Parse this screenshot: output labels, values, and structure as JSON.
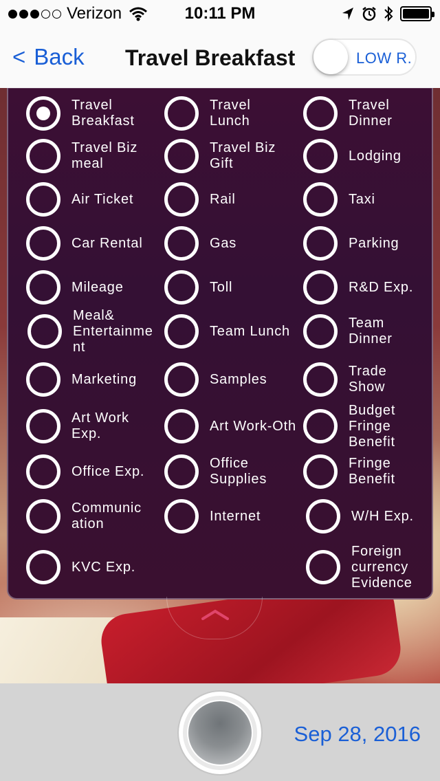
{
  "status_bar": {
    "carrier": "Verizon",
    "time": "10:11 PM",
    "signal_bars_filled": 3,
    "signal_bars_total": 5,
    "icons": [
      "wifi-icon",
      "location-arrow-icon",
      "alarm-icon",
      "bluetooth-icon",
      "battery-icon"
    ]
  },
  "nav": {
    "back_label": "Back",
    "back_chevron": "<",
    "title": "Travel Breakfast",
    "toggle_label": "LOW R.",
    "toggle_on": false
  },
  "expense_options": [
    {
      "label": "Travel\nBreakfast",
      "checked": true
    },
    {
      "label": "Travel\nLunch",
      "checked": false
    },
    {
      "label": "Travel\nDinner",
      "checked": false
    },
    {
      "label": "Travel Biz\nmeal",
      "checked": false
    },
    {
      "label": "Travel Biz\nGift",
      "checked": false
    },
    {
      "label": "Lodging",
      "checked": false
    },
    {
      "label": "Air Ticket",
      "checked": false
    },
    {
      "label": "Rail",
      "checked": false
    },
    {
      "label": "Taxi",
      "checked": false
    },
    {
      "label": "Car Rental",
      "checked": false
    },
    {
      "label": "Gas",
      "checked": false
    },
    {
      "label": "Parking",
      "checked": false
    },
    {
      "label": "Mileage",
      "checked": false
    },
    {
      "label": "Toll",
      "checked": false
    },
    {
      "label": "R&D Exp.",
      "checked": false
    },
    {
      "label": "Meal&\nEntertainme\nnt",
      "checked": false
    },
    {
      "label": "Team Lunch",
      "checked": false
    },
    {
      "label": "Team\nDinner",
      "checked": false
    },
    {
      "label": "Marketing",
      "checked": false
    },
    {
      "label": "Samples",
      "checked": false
    },
    {
      "label": "Trade\nShow",
      "checked": false
    },
    {
      "label": "Art Work\nExp.",
      "checked": false
    },
    {
      "label": "Art Work-Oth",
      "checked": false
    },
    {
      "label": "Budget\nFringe\nBenefit",
      "checked": false
    },
    {
      "label": "Office Exp.",
      "checked": false
    },
    {
      "label": "Office\nSupplies",
      "checked": false
    },
    {
      "label": "Fringe\nBenefit",
      "checked": false
    },
    {
      "label": "Communic\nation",
      "checked": false
    },
    {
      "label": "Internet",
      "checked": false
    },
    {
      "label": "W/H Exp.",
      "checked": false
    },
    {
      "label": "KVC Exp.",
      "checked": false
    },
    {
      "label": "Foreign\ncurrency\nEvidence",
      "checked": false
    }
  ],
  "bottom_bar": {
    "date": "Sep 28, 2016"
  },
  "colors": {
    "accent": "#1a5fd6",
    "panel": "#3a1032",
    "bottom_bar": "#d4d4d4",
    "chevron": "#e0456a"
  }
}
